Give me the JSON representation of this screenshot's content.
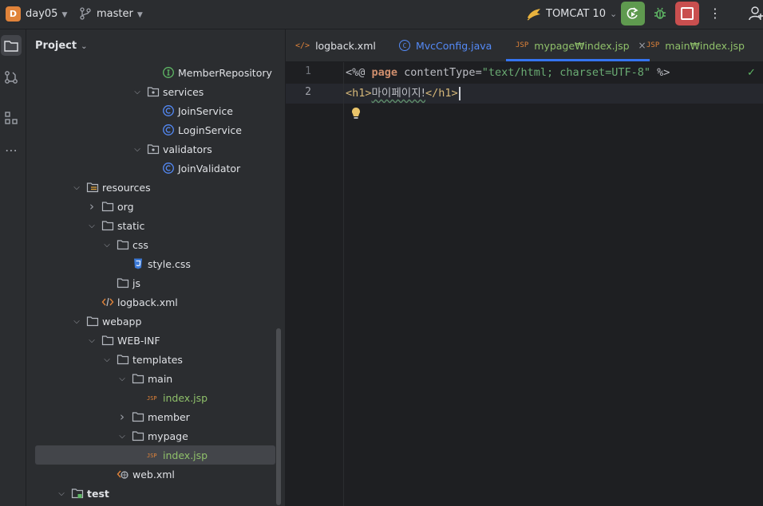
{
  "titlebar": {
    "project_badge": "D",
    "project_name": "day05",
    "branch_name": "master",
    "run_config": "TOMCAT 10"
  },
  "project_panel": {
    "title": "Project",
    "tree": [
      {
        "label": "MemberRepository",
        "icon": "interface-icon",
        "depth": 9,
        "chev": ""
      },
      {
        "label": "services",
        "icon": "package-icon",
        "depth": 8,
        "chev": "open"
      },
      {
        "label": "JoinService",
        "icon": "class-icon",
        "depth": 9,
        "chev": ""
      },
      {
        "label": "LoginService",
        "icon": "class-icon",
        "depth": 9,
        "chev": ""
      },
      {
        "label": "validators",
        "icon": "package-icon",
        "depth": 8,
        "chev": "open"
      },
      {
        "label": "JoinValidator",
        "icon": "class-icon",
        "depth": 9,
        "chev": ""
      },
      {
        "label": "resources",
        "icon": "resources-folder-icon",
        "depth": 4,
        "chev": "open"
      },
      {
        "label": "org",
        "icon": "folder-icon",
        "depth": 5,
        "chev": "closed"
      },
      {
        "label": "static",
        "icon": "folder-icon",
        "depth": 5,
        "chev": "open"
      },
      {
        "label": "css",
        "icon": "folder-icon",
        "depth": 6,
        "chev": "open"
      },
      {
        "label": "style.css",
        "icon": "css-file-icon",
        "depth": 7,
        "chev": ""
      },
      {
        "label": "js",
        "icon": "folder-icon",
        "depth": 6,
        "chev": ""
      },
      {
        "label": "logback.xml",
        "icon": "xml-file-icon",
        "depth": 5,
        "chev": ""
      },
      {
        "label": "webapp",
        "icon": "folder-icon",
        "depth": 4,
        "chev": "open"
      },
      {
        "label": "WEB-INF",
        "icon": "folder-icon",
        "depth": 5,
        "chev": "open"
      },
      {
        "label": "templates",
        "icon": "folder-icon",
        "depth": 6,
        "chev": "open"
      },
      {
        "label": "main",
        "icon": "folder-icon",
        "depth": 7,
        "chev": "open"
      },
      {
        "label": "index.jsp",
        "icon": "jsp-file-icon",
        "depth": 8,
        "chev": ""
      },
      {
        "label": "member",
        "icon": "folder-icon",
        "depth": 7,
        "chev": "closed"
      },
      {
        "label": "mypage",
        "icon": "folder-icon",
        "depth": 7,
        "chev": "open"
      },
      {
        "label": "index.jsp",
        "icon": "jsp-file-icon",
        "depth": 8,
        "chev": "",
        "selected": true
      },
      {
        "label": "web.xml",
        "icon": "web-xml-icon",
        "depth": 6,
        "chev": ""
      },
      {
        "label": "test",
        "icon": "test-folder-icon",
        "depth": 3,
        "chev": "open"
      }
    ]
  },
  "tabs": [
    {
      "label": "logback.xml",
      "icon": "</>"
    },
    {
      "label": "MvcConfig.java",
      "icon": "C"
    },
    {
      "label": "mypage₩index.jsp",
      "icon": "JSP",
      "active": true,
      "close": "×"
    },
    {
      "label": "main₩index.jsp",
      "icon": "JSP"
    }
  ],
  "editor": {
    "line_numbers": [
      "1",
      "2"
    ],
    "line1": {
      "open": "<%@ ",
      "directive": "page",
      "attr": " contentType=",
      "value": "\"text/html; charset=UTF-8\"",
      "close": " %>"
    },
    "line2": {
      "open_tag": "<h1>",
      "text": "마이페이지!",
      "close_tag": "</h1>"
    }
  },
  "colors": {
    "accent": "#3574f0",
    "run": "#5f9a4f",
    "stop": "#c94f4f",
    "project_badge": "#e0833a",
    "jsp_text": "#8fc06a"
  }
}
